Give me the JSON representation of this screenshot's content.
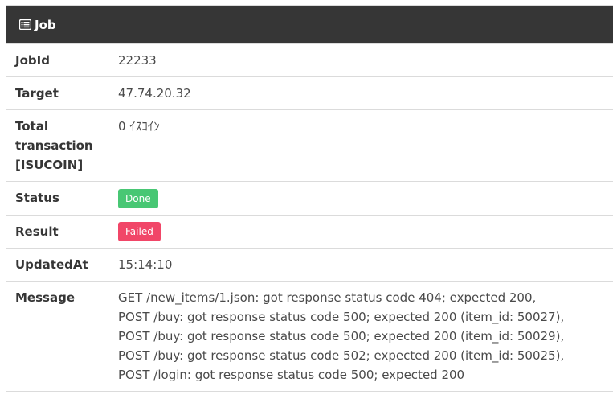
{
  "header": {
    "title": "Job",
    "icon": "list-icon"
  },
  "rows": {
    "jobid": {
      "label": "JobId",
      "value": "22233"
    },
    "target": {
      "label": "Target",
      "value": "47.74.20.32"
    },
    "total": {
      "label_lines": [
        "Total",
        "transaction",
        "[ISUCOIN]"
      ],
      "value": "0 ｲｽｺｲﾝ"
    },
    "status": {
      "label": "Status",
      "value": "Done",
      "color": "#48c774"
    },
    "result": {
      "label": "Result",
      "value": "Failed",
      "color": "#f14668"
    },
    "updated": {
      "label": "UpdatedAt",
      "value": "15:14:10"
    },
    "message": {
      "label": "Message",
      "lines": [
        "GET /new_items/1.json: got response status code 404; expected 200,",
        "POST /buy: got response status code 500; expected 200 (item_id: 50027),",
        "POST /buy: got response status code 500; expected 200 (item_id: 50029),",
        "POST /buy: got response status code 502; expected 200 (item_id: 50025),",
        "POST /login: got response status code 500; expected 200"
      ]
    }
  }
}
